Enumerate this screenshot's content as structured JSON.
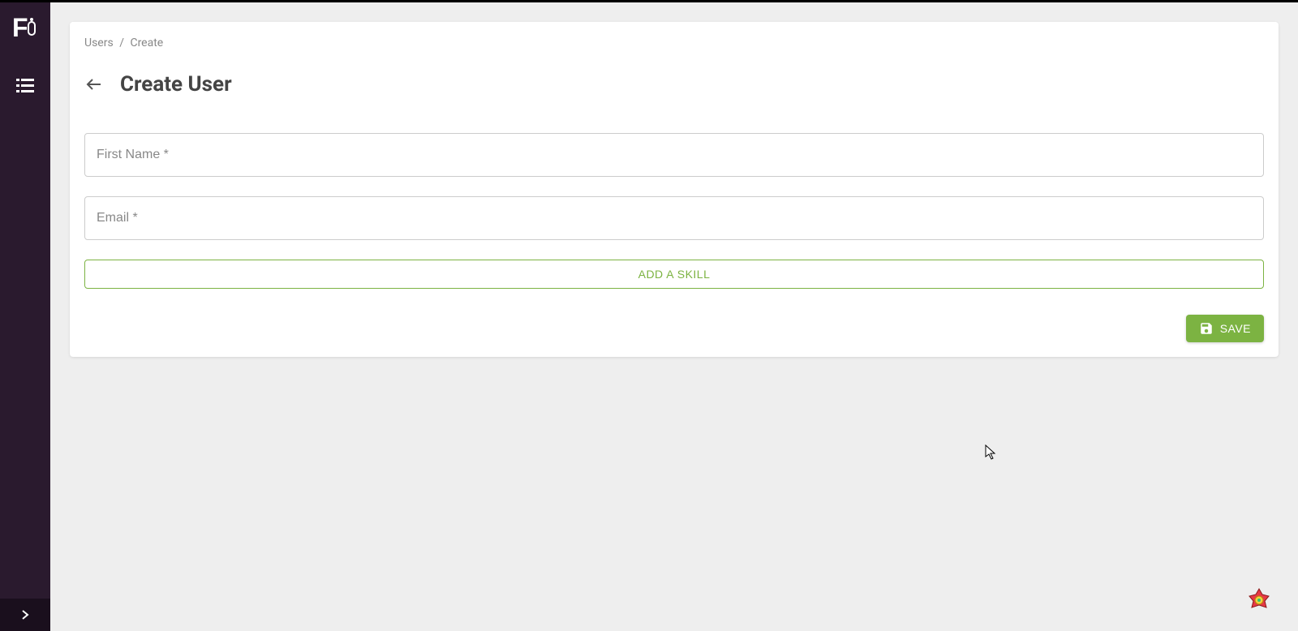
{
  "breadcrumb": {
    "root": "Users",
    "separator": "/",
    "current": "Create"
  },
  "page": {
    "title": "Create User"
  },
  "form": {
    "first_name_placeholder": "First Name *",
    "email_placeholder": "Email *",
    "add_skill_label": "ADD A SKILL"
  },
  "actions": {
    "save_label": "SAVE"
  }
}
